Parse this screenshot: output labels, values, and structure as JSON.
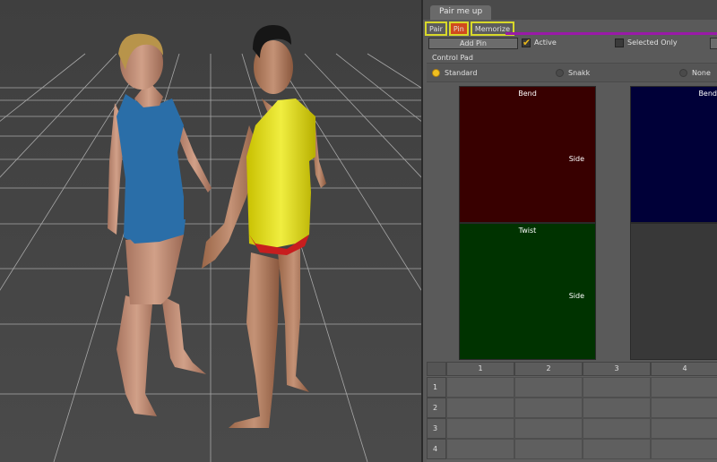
{
  "panel": {
    "tab_title": "Pair me up",
    "modes": [
      {
        "label": "Pair",
        "active": false
      },
      {
        "label": "Pin",
        "active": true
      },
      {
        "label": "Memorize",
        "active": false
      }
    ],
    "accent_color": "#9a1aa8",
    "highlight_color": "#d8d82a"
  },
  "toolbar": {
    "add_pin_label": "Add Pin",
    "active_label": "Active",
    "active_checked": true,
    "selected_only_label": "Selected Only",
    "selected_only_checked": false
  },
  "control_pad": {
    "label": "Control Pad",
    "options": [
      {
        "label": "Standard",
        "selected": true
      },
      {
        "label": "Snakk",
        "selected": false
      },
      {
        "label": "None",
        "selected": false
      }
    ],
    "pads": [
      {
        "name": "bend-side-pad",
        "top_label": "Bend",
        "side_label": "Side",
        "color": "#380000"
      },
      {
        "name": "bend-pad-2",
        "top_label": "Bend",
        "side_label": "",
        "color": "#000038"
      },
      {
        "name": "twist-side-pad",
        "top_label": "Twist",
        "side_label": "Side",
        "color": "#003300"
      },
      {
        "name": "empty-pad",
        "top_label": "",
        "side_label": "",
        "color": "#383838"
      }
    ]
  },
  "grid": {
    "columns": [
      "1",
      "2",
      "3",
      "4"
    ],
    "rows": [
      "1",
      "2",
      "3",
      "4"
    ]
  }
}
